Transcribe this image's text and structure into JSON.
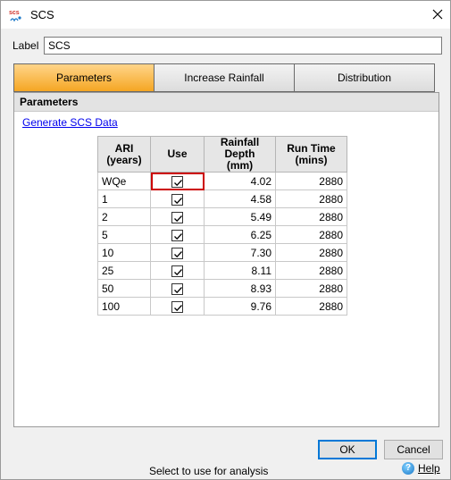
{
  "window": {
    "title": "SCS",
    "icon": "scs-app-icon"
  },
  "label_field": {
    "caption": "Label",
    "value": "SCS"
  },
  "tabs": [
    {
      "label": "Parameters",
      "active": true
    },
    {
      "label": "Increase Rainfall",
      "active": false
    },
    {
      "label": "Distribution",
      "active": false
    }
  ],
  "section": {
    "title": "Parameters",
    "link": "Generate SCS Data"
  },
  "table": {
    "headers": {
      "ari": "ARI\n(years)",
      "use": "Use",
      "depth": "Rainfall Depth\n(mm)",
      "time": "Run Time\n(mins)"
    },
    "rows": [
      {
        "ari": "WQe",
        "use": true,
        "depth": "4.02",
        "time": "2880"
      },
      {
        "ari": "1",
        "use": true,
        "depth": "4.58",
        "time": "2880"
      },
      {
        "ari": "2",
        "use": true,
        "depth": "5.49",
        "time": "2880"
      },
      {
        "ari": "5",
        "use": true,
        "depth": "6.25",
        "time": "2880"
      },
      {
        "ari": "10",
        "use": true,
        "depth": "7.30",
        "time": "2880"
      },
      {
        "ari": "25",
        "use": true,
        "depth": "8.11",
        "time": "2880"
      },
      {
        "ari": "50",
        "use": true,
        "depth": "8.93",
        "time": "2880"
      },
      {
        "ari": "100",
        "use": true,
        "depth": "9.76",
        "time": "2880"
      }
    ]
  },
  "buttons": {
    "ok": "OK",
    "cancel": "Cancel"
  },
  "status": "Select to use for analysis",
  "help": {
    "label": "Help",
    "icon": "help-icon"
  },
  "colors": {
    "active_tab": "#f5a623",
    "focus_outline": "#cc0000",
    "link": "#0000ee"
  }
}
